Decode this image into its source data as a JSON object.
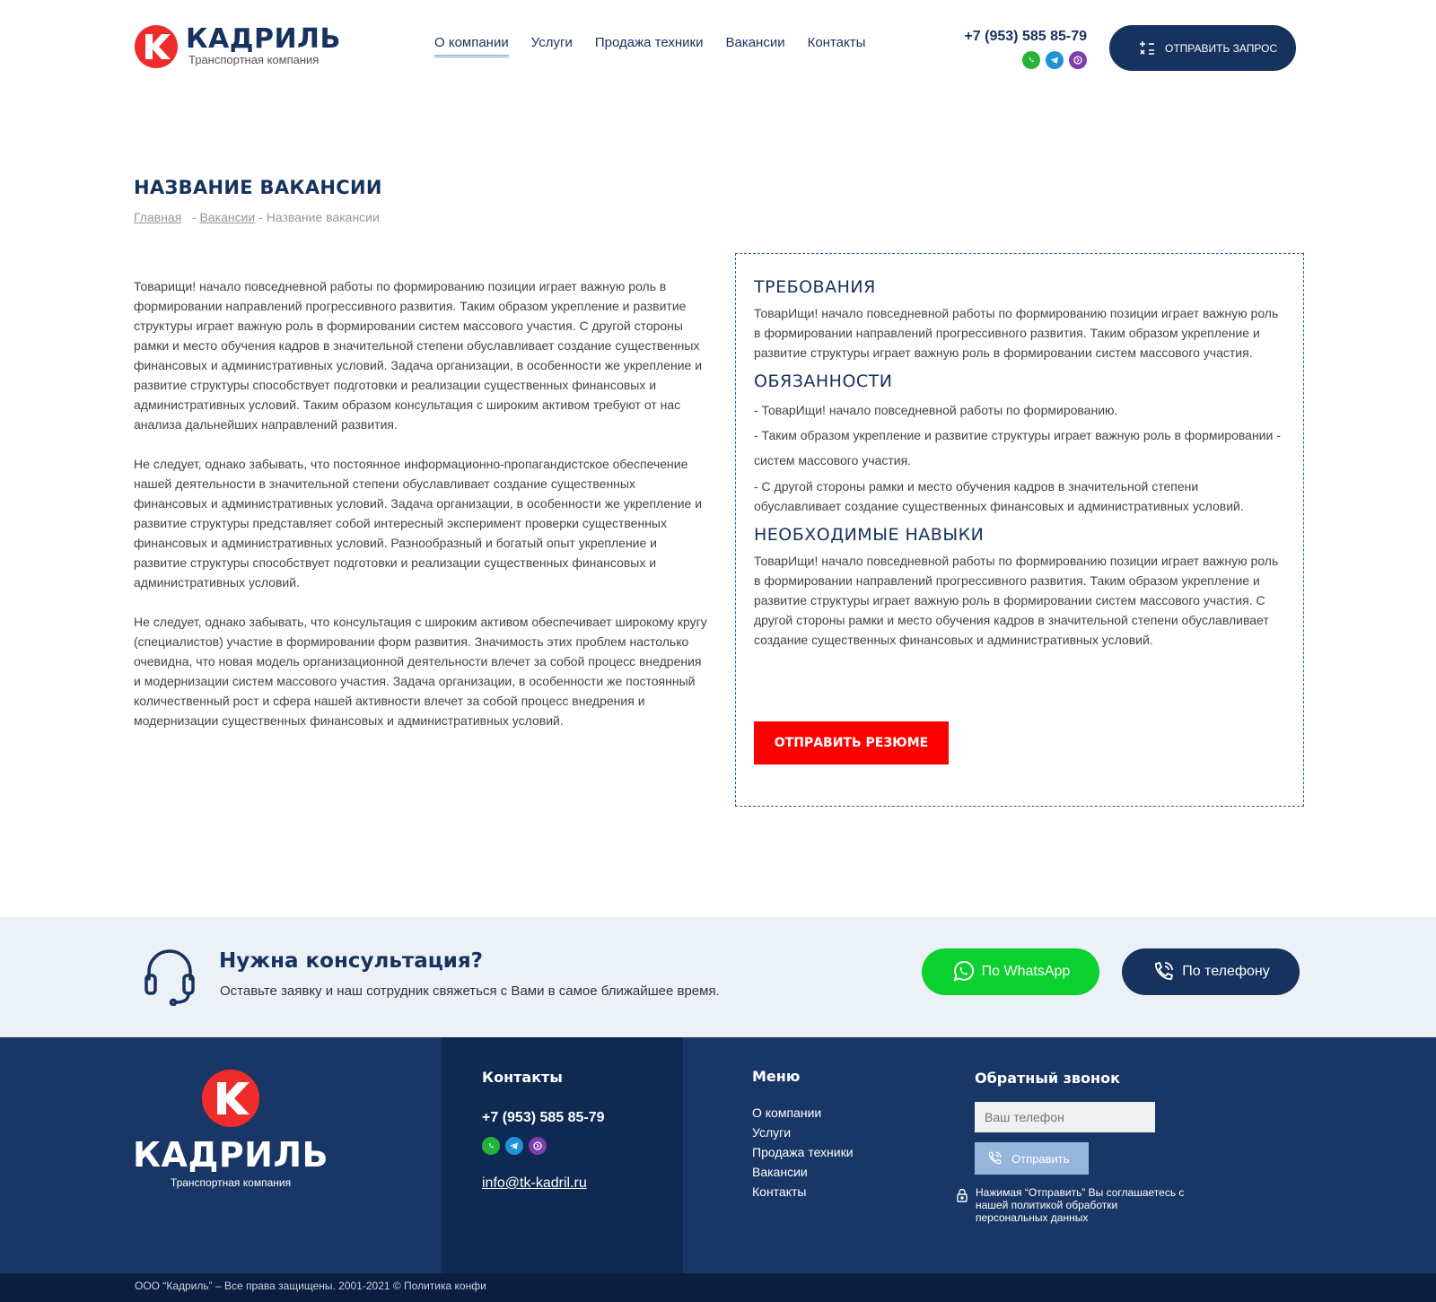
{
  "header": {
    "logo_name": "КАДРИЛЬ",
    "logo_sub": "Транспортная компания",
    "nav": [
      "О компании",
      "Услуги",
      "Продажа техники",
      "Вакансии",
      "Контакты"
    ],
    "phone": "+7 (953) 585 85-79",
    "send_request": "ОТПРАВИТЬ ЗАПРОС"
  },
  "page": {
    "title": "НАЗВАНИЕ ВАКАНСИИ",
    "breadcrumb": [
      "Главная",
      "Вакансии",
      "Название вакансии"
    ]
  },
  "left_text": [
    "Товарищи! начало повседневной работы по формированию позиции играет важную роль в формировании направлений прогрессивного развития. Таким образом укрепление и развитие структуры играет важную роль в формировании систем массового участия. С другой стороны рамки и место обучения кадров в значительной степени обуславливает создание существенных финансовых и административных условий. Задача организации, в особенности же укрепление и развитие структуры способствует подготовки и реализации существенных финансовых и административных условий. Таким образом консультация с широким активом требуют от нас анализа дальнейших направлений развития.",
    "Не следует, однако забывать, что постоянное информационно-пропагандистское обеспечение нашей деятельности в значительной степени обуславливает создание существенных финансовых и административных условий. Задача организации, в особенности же укрепление и развитие структуры представляет собой интересный эксперимент проверки существенных финансовых и административных условий. Разнообразный и богатый опыт укрепление и развитие структуры способствует подготовки и реализации существенных финансовых и административных условий.",
    "Не следует, однако забывать, что консультация с широким активом обеспечивает широкому кругу (специалистов) участие в формировании форм развития. Значимость этих проблем настолько очевидна, что новая модель организационной деятельности влечет за собой процесс внедрения и модернизации систем массового участия. Задача организации, в особенности же постоянный количественный рост и сфера нашей активности влечет за собой процесс внедрения и модернизации существенных финансовых и административных условий."
  ],
  "requirements": {
    "title": "ТРЕБОВАНИЯ",
    "text": "ТоварИщи! начало повседневной работы по формированию позиции играет важную роль в формировании направлений прогрессивного развития. Таким образом укрепление и развитие структуры играет важную роль в формировании систем массового участия."
  },
  "duties": {
    "title": "ОБЯЗАННОСТИ",
    "items": [
      "- ТоварИщи! начало повседневной работы по формированию.",
      "- Таким образом укрепление и развитие структуры играет важную роль в формировании - систем массового участия.",
      "- С другой стороны рамки и место обучения кадров в значительной степени обуславливает создание существенных финансовых и административных условий."
    ]
  },
  "skills": {
    "title": "НЕОБХОДИМЫЕ НАВЫКИ",
    "text": "ТоварИщи! начало повседневной работы по формированию позиции играет важную роль в формировании направлений прогрессивного развития. Таким образом укрепление и развитие структуры играет важную роль в формировании систем массового участия. С другой стороны рамки и место обучения кадров в значительной степени обуславливает создание существенных финансовых и административных условий."
  },
  "resume_button": "ОТПРАВИТЬ РЕЗЮМЕ",
  "consult": {
    "title": "Нужна консультация?",
    "subtitle": "Оставьте заявку и наш сотрудник свяжеться с Вами в самое ближайшее время.",
    "whatsapp_btn": "По WhatsApp",
    "phone_btn": "По телефону"
  },
  "footer": {
    "logo_name": "КАДРИЛЬ",
    "logo_sub": "Транспортная компания",
    "contacts_title": "Контакты",
    "phone": "+7 (953) 585 85-79",
    "email": "info@tk-kadril.ru",
    "menu_title": "Меню",
    "menu": [
      "О компании",
      "Услуги",
      "Продажа техники",
      "Вакансии",
      "Контакты"
    ],
    "callback_title": "Обратный звонок",
    "phone_placeholder": "Ваш телефон",
    "send_label": "Отправить",
    "policy": "Нажимая “Отправить” Вы соглашаетесь с нашей политикой обработки персональных данных",
    "copyright": "ООО “Кадриль” – Все права защищены.  2001-2021 © Политика конфи"
  },
  "colors": {
    "brand_dark": "#16325e",
    "accent_red": "#ff0000",
    "whatsapp_green": "#0bd02f",
    "footer_bg": "#193766"
  },
  "icons": [
    "logo-k-icon",
    "whatsapp-icon",
    "telegram-icon",
    "viber-icon",
    "calculator-icon",
    "headset-icon",
    "phone-icon",
    "lock-icon"
  ]
}
